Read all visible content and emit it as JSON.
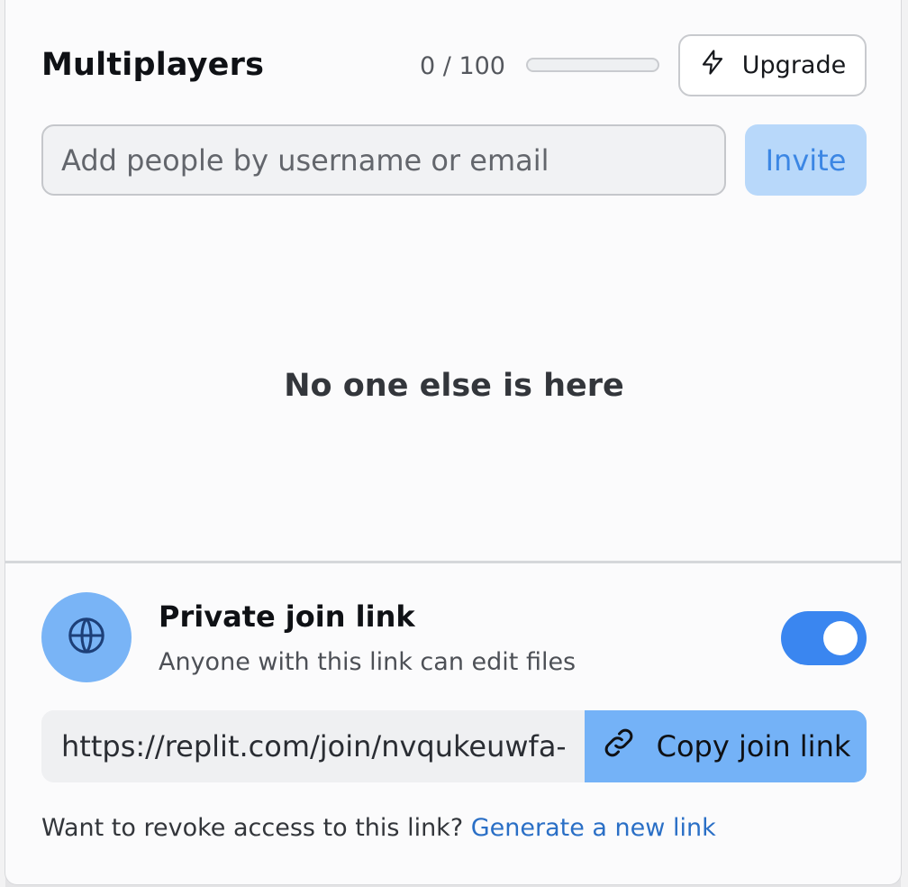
{
  "header": {
    "title": "Multiplayers",
    "count_text": "0 / 100",
    "progress_fraction": 0,
    "upgrade_label": "Upgrade",
    "upgrade_icon": "lightning-bolt-icon"
  },
  "invite": {
    "placeholder": "Add people by username or email",
    "value": "",
    "button_label": "Invite"
  },
  "empty_state": "No one else is here",
  "join_link": {
    "icon": "globe-icon",
    "title": "Private join link",
    "subtitle": "Anyone with this link can edit files",
    "enabled": true,
    "url": "https://replit.com/join/nvqukeuwfa-",
    "copy_label": "Copy join link",
    "copy_icon": "link-icon"
  },
  "revoke": {
    "text": "Want to revoke access to this link?",
    "link_label": "Generate a new link"
  },
  "colors": {
    "accent": "#3a86f0",
    "invite_button_bg": "#b8d8fa",
    "copy_button_bg": "#74b2f7",
    "link_color": "#2a6fc6"
  }
}
